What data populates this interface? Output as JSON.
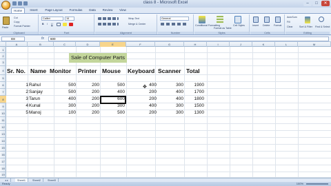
{
  "window": {
    "title": "class 8 - Microsoft Excel"
  },
  "ribbon": {
    "tabs": [
      "Home",
      "Insert",
      "Page Layout",
      "Formulas",
      "Data",
      "Review",
      "View"
    ],
    "active_tab": "Home",
    "clipboard": {
      "paste": "Paste",
      "cut": "Cut",
      "copy": "Copy",
      "format_painter": "Format Painter",
      "label": "Clipboard"
    },
    "font": {
      "name": "Calibri",
      "size": "16",
      "label": "Font"
    },
    "alignment": {
      "wrap": "Wrap Text",
      "merge": "Merge & Center",
      "label": "Alignment"
    },
    "number": {
      "format": "General",
      "label": "Number"
    },
    "styles": {
      "conditional": "Conditional Formatting",
      "as_table": "Format as Table",
      "cell_styles": "Cell Styles",
      "label": "Styles"
    },
    "cells": {
      "insert": "Insert",
      "delete": "Delete",
      "format": "Format",
      "label": "Cells"
    },
    "editing": {
      "autosum": "AutoSum",
      "fill": "Fill",
      "clear": "Clear",
      "sort": "Sort & Filter",
      "find": "Find & Select",
      "label": "Editing"
    }
  },
  "formula_bar": {
    "name_box": "E8",
    "fx": "fx",
    "value": "600"
  },
  "columns": [
    "A",
    "B",
    "C",
    "D",
    "E",
    "F",
    "G",
    "H",
    "I",
    "J",
    "K",
    "L",
    "M"
  ],
  "rows": [
    "1",
    "2",
    "3",
    "4",
    "5",
    "6",
    "7",
    "8",
    "9",
    "10",
    "11",
    "12",
    "13",
    "14",
    "15",
    "16",
    "17",
    "18",
    "19",
    "20",
    "21",
    "22",
    "23",
    "24",
    "25"
  ],
  "sheet": {
    "title": "Sale of Computer Parts",
    "headers": [
      "Sr. No.",
      "Name",
      "Monitor",
      "Printer",
      "Mouse",
      "Keyboard",
      "Scanner",
      "Total"
    ],
    "records": [
      {
        "sr": "1",
        "name": "Rahul",
        "monitor": "500",
        "printer": "200",
        "mouse": "500",
        "keyboard": "400",
        "scanner": "300",
        "total": "1900"
      },
      {
        "sr": "2",
        "name": "Sanjay",
        "monitor": "500",
        "printer": "200",
        "mouse": "400",
        "keyboard": "200",
        "scanner": "400",
        "total": "1700"
      },
      {
        "sr": "3",
        "name": "Tarun",
        "monitor": "400",
        "printer": "200",
        "mouse": "600",
        "keyboard": "200",
        "scanner": "400",
        "total": "1800"
      },
      {
        "sr": "4",
        "name": "Kunal",
        "monitor": "300",
        "printer": "200",
        "mouse": "300",
        "keyboard": "400",
        "scanner": "300",
        "total": "1500"
      },
      {
        "sr": "5",
        "name": "Manoj",
        "monitor": "100",
        "printer": "200",
        "mouse": "500",
        "keyboard": "200",
        "scanner": "300",
        "total": "1300"
      }
    ]
  },
  "sheet_tabs": [
    "Sheet1",
    "Sheet2",
    "Sheet3"
  ],
  "status": {
    "text": "Ready",
    "zoom": "100%"
  },
  "colors": {
    "title_fill": "#c3d69b",
    "selection": "#f7d58c",
    "ribbon_accent": "#8ba5cc"
  }
}
